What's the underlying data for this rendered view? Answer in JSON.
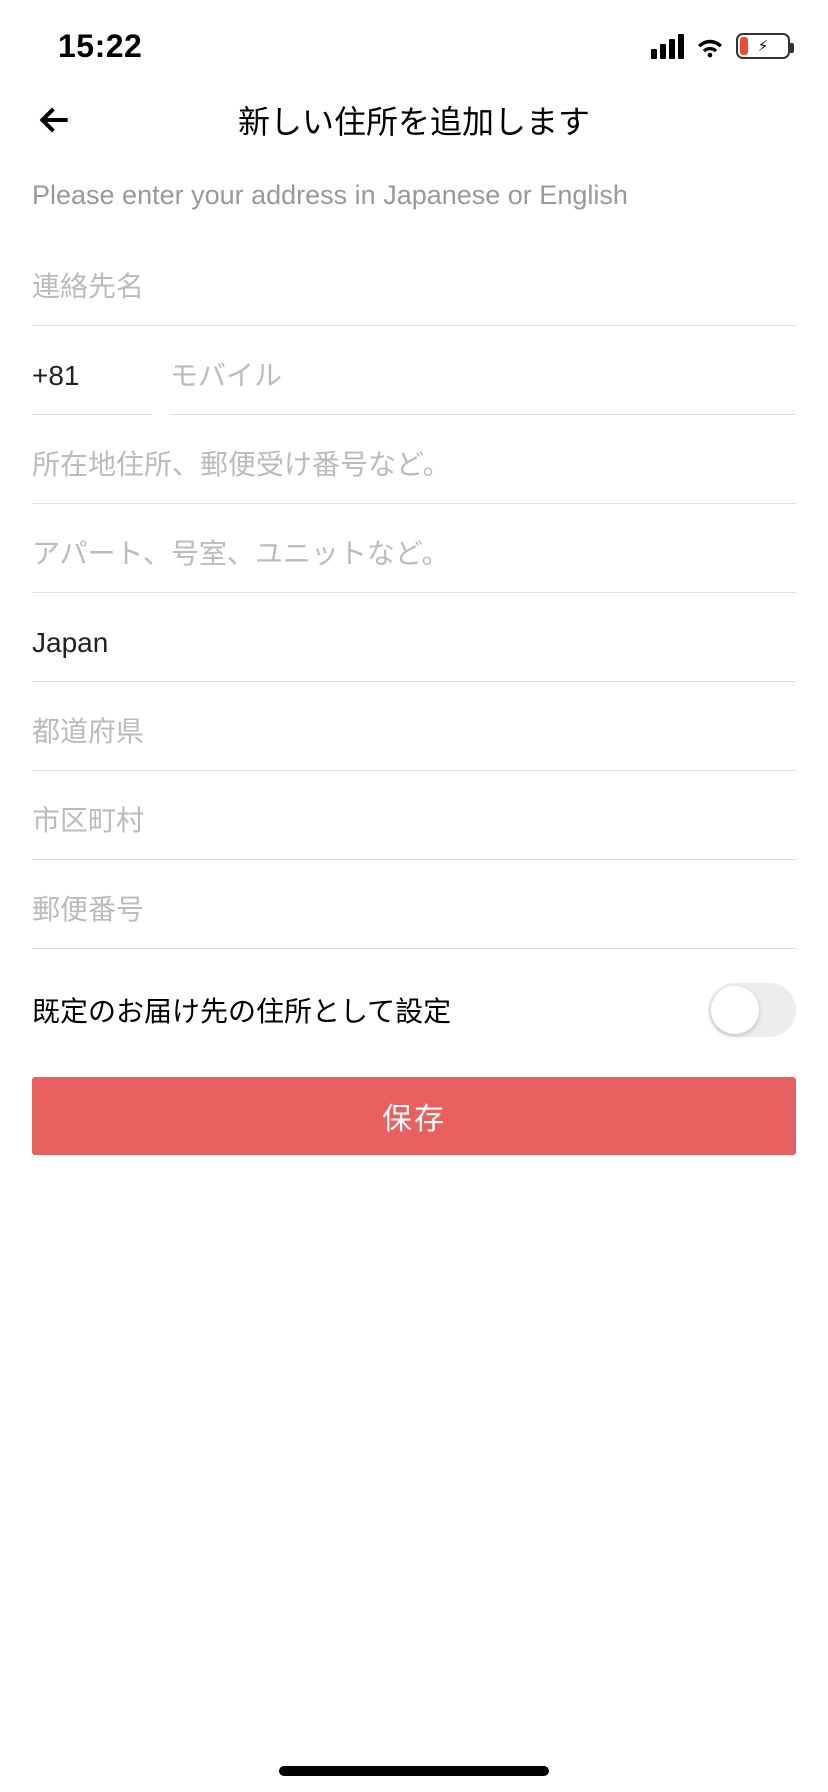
{
  "status": {
    "time": "15:22"
  },
  "nav": {
    "title": "新しい住所を追加します"
  },
  "instruction": "Please enter your address in Japanese or English",
  "form": {
    "contact_name_placeholder": "連絡先名",
    "phone_code": "+81",
    "phone_placeholder": "モバイル",
    "street_placeholder": "所在地住所、郵便受け番号など。",
    "apt_placeholder": "アパート、号室、ユニットなど。",
    "country_value": "Japan",
    "prefecture_placeholder": "都道府県",
    "city_placeholder": "市区町村",
    "postal_placeholder": "郵便番号"
  },
  "default_toggle": {
    "label": "既定のお届け先の住所として設定"
  },
  "save_button": {
    "label": "保存"
  }
}
